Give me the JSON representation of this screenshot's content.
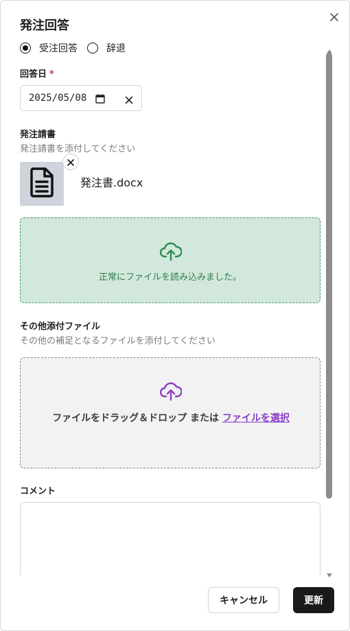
{
  "dialog": {
    "title": "発注回答",
    "close_icon": "close-icon"
  },
  "response": {
    "options": [
      {
        "label": "受注回答",
        "selected": true
      },
      {
        "label": "辞退",
        "selected": false
      }
    ]
  },
  "answer_date": {
    "label": "回答日",
    "required_mark": "*",
    "value": "2025/05/08"
  },
  "order_sheet": {
    "label": "発注請書",
    "help": "発注請書を添付してください",
    "file_name": "発注書.docx",
    "success_message": "正常にファイルを読み込みました。"
  },
  "other_files": {
    "label": "その他添付ファイル",
    "help": "その他の補足となるファイルを添付してください",
    "drop_text": "ファイルをドラッグ＆ドロップ または ",
    "select_link": "ファイルを選択"
  },
  "comment": {
    "label": "コメント",
    "value": ""
  },
  "footer": {
    "cancel_label": "キャンセル",
    "update_label": "更新"
  },
  "colors": {
    "success_bg": "#d2e8dc",
    "success_text": "#2e7d4f",
    "accent_purple": "#8b3fc8",
    "primary_button": "#1a1a1a"
  }
}
